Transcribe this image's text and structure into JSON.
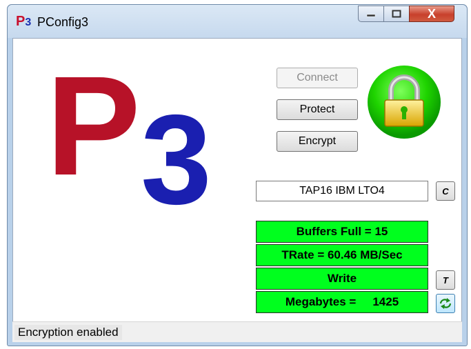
{
  "window": {
    "title": "PConfig3",
    "icon_text_p": "P",
    "icon_text_num": "3",
    "controls": {
      "minimize": "–",
      "maximize": "□",
      "close": "X"
    }
  },
  "logo": {
    "letter": "P",
    "digit": "3",
    "colors": {
      "p": "#b71228",
      "digit": "#1a1fb0"
    }
  },
  "buttons": {
    "connect": {
      "label": "Connect",
      "enabled": false
    },
    "protect": {
      "label": "Protect",
      "enabled": true
    },
    "encrypt": {
      "label": "Encrypt",
      "enabled": true
    }
  },
  "lock": {
    "icon": "padlock-locked-icon",
    "state": "locked",
    "color": "#00d000"
  },
  "device": {
    "value": "TAP16 IBM LTO4",
    "clear_button": "C"
  },
  "stats": {
    "buffers": "Buffers Full = 15",
    "trate": "TRate = 60.46 MB/Sec",
    "mode": "Write",
    "megabytes_label": "Megabytes =",
    "megabytes_value": "1425",
    "color": "#00ff1e"
  },
  "side_buttons": {
    "t_label": "T",
    "refresh_icon": "refresh-arrows-icon"
  },
  "status": {
    "text": "Encryption enabled"
  }
}
